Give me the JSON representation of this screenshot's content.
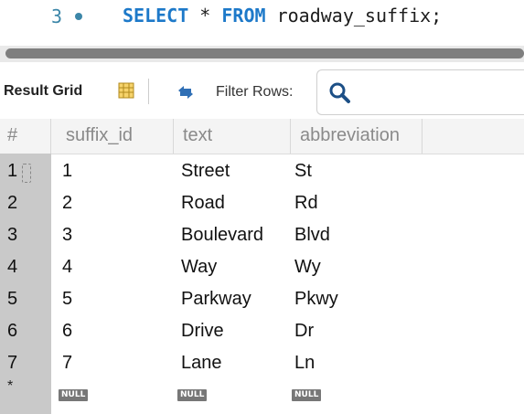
{
  "editor": {
    "line_number": "3",
    "code": {
      "kw1": "SELECT",
      "star": " * ",
      "kw2": "FROM",
      "rest": " roadway_suffix;"
    }
  },
  "toolbar": {
    "result_grid_label": "Result Grid",
    "filter_label": "Filter Rows:"
  },
  "grid": {
    "columns": [
      "#",
      "suffix_id",
      "text",
      "abbreviation"
    ],
    "rows": [
      {
        "num": "1",
        "suffix_id": "1",
        "text": "Street",
        "abbreviation": "St"
      },
      {
        "num": "2",
        "suffix_id": "2",
        "text": "Road",
        "abbreviation": "Rd"
      },
      {
        "num": "3",
        "suffix_id": "3",
        "text": "Boulevard",
        "abbreviation": "Blvd"
      },
      {
        "num": "4",
        "suffix_id": "4",
        "text": "Way",
        "abbreviation": "Wy"
      },
      {
        "num": "5",
        "suffix_id": "5",
        "text": "Parkway",
        "abbreviation": "Pkwy"
      },
      {
        "num": "6",
        "suffix_id": "6",
        "text": "Drive",
        "abbreviation": "Dr"
      },
      {
        "num": "7",
        "suffix_id": "7",
        "text": "Lane",
        "abbreviation": "Ln"
      }
    ],
    "new_row_marker": "*",
    "null_label": "NULL"
  },
  "icons": {
    "grid": "grid-icon",
    "refresh": "refresh-icon",
    "search": "search-icon"
  },
  "colors": {
    "keyword": "#1d79c9",
    "rownum_bg": "#c9c9c9",
    "header_text": "#8a8a8a"
  }
}
